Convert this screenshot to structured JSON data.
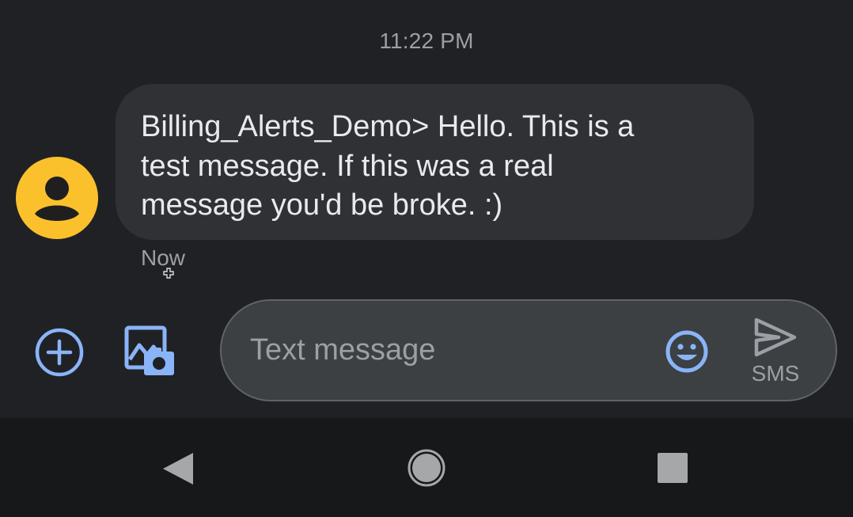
{
  "conversation": {
    "timestamp": "11:22 PM",
    "message": {
      "text": "Billing_Alerts_Demo> Hello. This is a test message. If this was a real message you'd be broke. :)",
      "status": "Now",
      "avatar_icon": "person-icon",
      "avatar_color": "#fbc12d"
    }
  },
  "composer": {
    "placeholder": "Text message",
    "value": "",
    "add_icon": "plus-circle-icon",
    "gallery_icon": "gallery-camera-icon",
    "emoji_icon": "emoji-icon",
    "send_icon": "send-icon",
    "send_label": "SMS",
    "accent_color": "#8ab4f8"
  },
  "navbar": {
    "back_icon": "back-triangle-icon",
    "home_icon": "home-circle-icon",
    "recents_icon": "recents-square-icon"
  }
}
